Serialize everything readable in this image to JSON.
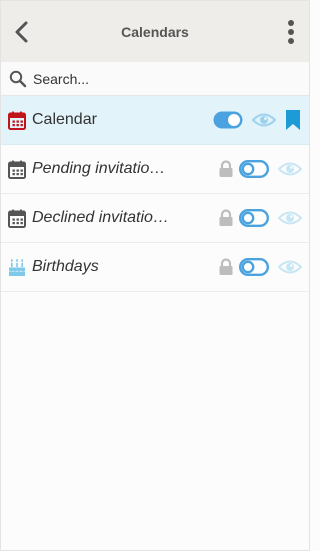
{
  "header": {
    "title": "Calendars"
  },
  "search": {
    "placeholder": "Search..."
  },
  "colors": {
    "accent": "#4aa3df",
    "primary_calendar": "#c0141a",
    "birthday": "#7ec8ea",
    "lock": "#bdbdbd"
  },
  "calendars": [
    {
      "label": "Calendar",
      "icon": "calendar-icon",
      "enabled": true,
      "visible": true,
      "default": true,
      "locked": false,
      "selected": true
    },
    {
      "label": "Pending invitatio…",
      "icon": "calendar-icon",
      "enabled": false,
      "visible": true,
      "default": false,
      "locked": true,
      "selected": false
    },
    {
      "label": "Declined invitatio…",
      "icon": "calendar-icon",
      "enabled": false,
      "visible": true,
      "default": false,
      "locked": true,
      "selected": false
    },
    {
      "label": "Birthdays",
      "icon": "birthday-cake-icon",
      "enabled": false,
      "visible": true,
      "default": false,
      "locked": true,
      "selected": false
    }
  ]
}
